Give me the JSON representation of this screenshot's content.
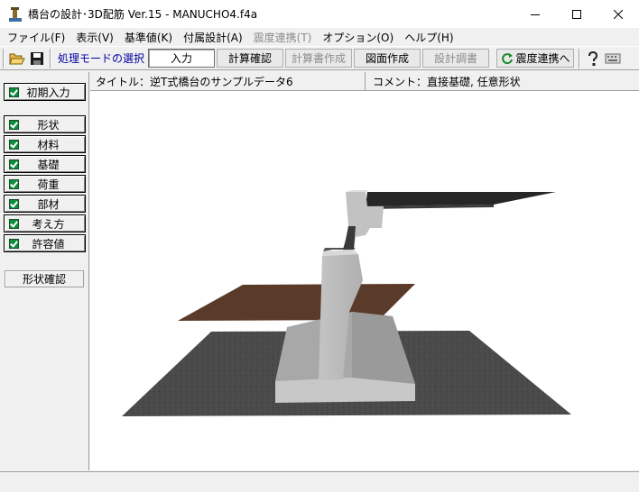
{
  "window": {
    "title": "橋台の設計･3D配筋 Ver.15 - MANUCHO4.f4a",
    "controls": {
      "minimize": "—",
      "maximize": "☐",
      "close": "✕"
    }
  },
  "menu": [
    {
      "label": "ファイル(F)",
      "enabled": true
    },
    {
      "label": "表示(V)",
      "enabled": true
    },
    {
      "label": "基準値(K)",
      "enabled": true
    },
    {
      "label": "付属設計(A)",
      "enabled": true
    },
    {
      "label": "震度連携(T)",
      "enabled": false
    },
    {
      "label": "オプション(O)",
      "enabled": true
    },
    {
      "label": "ヘルプ(H)",
      "enabled": true
    }
  ],
  "toolbar": {
    "open_icon": "folder-open-icon",
    "save_icon": "floppy-disk-icon",
    "mode_label": "処理モードの選択",
    "buttons": [
      {
        "label": "入力",
        "state": "pressed"
      },
      {
        "label": "計算確認",
        "state": "enabled"
      },
      {
        "label": "計算書作成",
        "state": "disabled"
      },
      {
        "label": "図面作成",
        "state": "enabled"
      },
      {
        "label": "設計調書",
        "state": "disabled"
      }
    ],
    "link_button": "震度連携へ",
    "help_icon": "question-mark-icon",
    "keyboard_icon": "keyboard-icon"
  },
  "sidebar": {
    "initial_input": "初期入力",
    "items": [
      "形状",
      "材料",
      "基礎",
      "荷重",
      "部材",
      "考え方",
      "許容値"
    ],
    "shape_check": "形状確認"
  },
  "info": {
    "title": "タイトル：逆T式橋台のサンプルデータ6",
    "comment": "コメント：直接基礎, 任意形状"
  },
  "colors": {
    "check_green": "#0b8f3c",
    "mode_label": "#0000a0",
    "concrete": "#bfbfbf",
    "ground": "#4a4a4a",
    "soil": "#5a3a28",
    "deck": "#262626"
  }
}
